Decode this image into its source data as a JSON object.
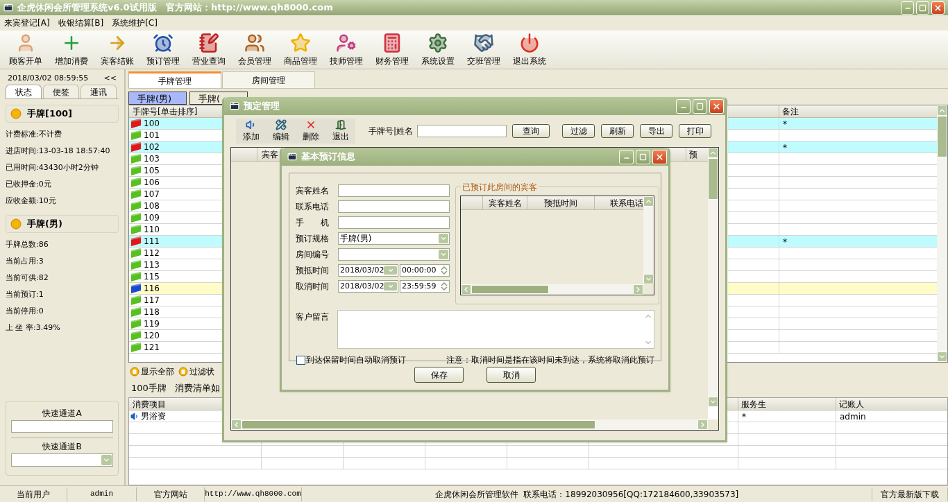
{
  "window": {
    "title": "企虎休闲会所管理系统v6.0试用版   官方网站：http://www.qh8000.com"
  },
  "menu": [
    "来宾登记[A]",
    "收银结算[B]",
    "系统维护[C]"
  ],
  "toolbar": [
    {
      "label": "顾客开单",
      "kind": "person"
    },
    {
      "label": "增加消费",
      "kind": "plus"
    },
    {
      "label": "宾客结账",
      "kind": "checkout"
    },
    {
      "label": "预订管理",
      "kind": "clock"
    },
    {
      "label": "营业查询",
      "kind": "notepad"
    },
    {
      "label": "会员管理",
      "kind": "people"
    },
    {
      "label": "商品管理",
      "kind": "star"
    },
    {
      "label": "技师管理",
      "kind": "staff"
    },
    {
      "label": "财务管理",
      "kind": "calculator"
    },
    {
      "label": "系统设置",
      "kind": "settings"
    },
    {
      "label": "交班管理",
      "kind": "handshake"
    },
    {
      "label": "退出系统",
      "kind": "power"
    }
  ],
  "sidebar": {
    "datetime": "2018/03/02 08:59:55",
    "collapse": "<<",
    "tabs": [
      {
        "label": "状态",
        "selected": true
      },
      {
        "label": "便签",
        "selected": false
      },
      {
        "label": "通讯",
        "selected": false
      }
    ],
    "tag_card": {
      "title": "手牌[100]",
      "lines": [
        "计费标准:不计费",
        "进店时间:13-03-18 18:57:40",
        "已用时间:43430小时2分钟",
        "已收押金:0元",
        "应收金额:10元"
      ]
    },
    "type_card": {
      "title": "手牌(男)",
      "lines": [
        "手牌总数:86",
        "当前占用:3",
        "当前可供:82",
        "当前预订:1",
        "当前停用:0",
        "上 坐 率:3.49%"
      ]
    },
    "quick_a": {
      "label": "快速通道A"
    },
    "quick_b": {
      "label": "快速通道B"
    }
  },
  "main_tabs": [
    {
      "label": "手牌管理",
      "selected": true
    },
    {
      "label": "房间管理",
      "selected": false
    }
  ],
  "sub_tabs": [
    {
      "label": "手牌(男)",
      "selected": true
    },
    {
      "label": "手牌(",
      "selected": false
    }
  ],
  "tags_table": {
    "columns": [
      "手牌号[单击排序]",
      "备注"
    ],
    "rows": [
      {
        "number": "100",
        "kind": "occupied",
        "remark": "*"
      },
      {
        "number": "101",
        "kind": "free",
        "remark": ""
      },
      {
        "number": "102",
        "kind": "occupied",
        "remark": "*"
      },
      {
        "number": "103",
        "kind": "free",
        "remark": ""
      },
      {
        "number": "105",
        "kind": "free",
        "remark": ""
      },
      {
        "number": "106",
        "kind": "free",
        "remark": ""
      },
      {
        "number": "107",
        "kind": "free",
        "remark": ""
      },
      {
        "number": "108",
        "kind": "free",
        "remark": ""
      },
      {
        "number": "109",
        "kind": "free",
        "remark": ""
      },
      {
        "number": "110",
        "kind": "free",
        "remark": ""
      },
      {
        "number": "111",
        "kind": "occupied",
        "remark": "*"
      },
      {
        "number": "112",
        "kind": "free",
        "remark": ""
      },
      {
        "number": "113",
        "kind": "free",
        "remark": ""
      },
      {
        "number": "115",
        "kind": "free",
        "remark": ""
      },
      {
        "number": "116",
        "kind": "reserved",
        "remark": ""
      },
      {
        "number": "117",
        "kind": "free",
        "remark": ""
      },
      {
        "number": "118",
        "kind": "free",
        "remark": ""
      },
      {
        "number": "119",
        "kind": "free",
        "remark": ""
      },
      {
        "number": "120",
        "kind": "free",
        "remark": ""
      },
      {
        "number": "121",
        "kind": "free",
        "remark": ""
      }
    ]
  },
  "list_actions": [
    "显示全部",
    "过滤状"
  ],
  "consumption": {
    "tag": "100手牌",
    "title": "消费清单如",
    "columns": [
      "消费项目",
      "服务生",
      "记账人"
    ],
    "rows": [
      {
        "item": "男浴资",
        "waiter": "*",
        "clerk": "admin"
      }
    ]
  },
  "status_bar": [
    "当前用户",
    "admin",
    "官方网站",
    "http://www.qh8000.com",
    "企虎休闲会所管理软件  联系电话：18992030956[QQ:172184600,33903573]",
    "官方最新版下载"
  ],
  "reservation_window": {
    "title": "预定管理",
    "toolbar": [
      {
        "label": "添加",
        "kind": "add"
      },
      {
        "label": "编辑",
        "kind": "edit"
      },
      {
        "label": "删除",
        "kind": "delete"
      },
      {
        "label": "退出",
        "kind": "exit"
      }
    ],
    "search_label": "手牌号|姓名",
    "buttons": [
      "查询",
      "过滤",
      "刷新",
      "导出",
      "打印"
    ],
    "columns": [
      "宾客",
      "预"
    ]
  },
  "booking_dialog": {
    "title": "基本预订信息",
    "fields": [
      {
        "label": "宾客姓名",
        "kind": "text"
      },
      {
        "label": "联系电话",
        "kind": "text"
      },
      {
        "label": "手　　机",
        "kind": "text"
      },
      {
        "label": "预订规格",
        "kind": "select",
        "value": "手牌(男)"
      },
      {
        "label": "房间编号",
        "kind": "select"
      },
      {
        "label": "预抵时间",
        "kind": "datetime",
        "value": "2018/03/02",
        "time": "00:00:00"
      },
      {
        "label": "取消时间",
        "kind": "datetime",
        "value": "2018/03/02",
        "time": "23:59:59"
      }
    ],
    "guests": {
      "title": "已预订此房间的宾客",
      "columns": [
        "宾客姓名",
        "预抵时间",
        "联系电话"
      ]
    },
    "message_label": "客户留言",
    "auto_cancel": {
      "label": "到达保留时间自动取消预订",
      "checked": false
    },
    "note": "注意：取消时间是指在该时间未到达，系统将取消此预订",
    "buttons": [
      "保存",
      "取消"
    ]
  }
}
